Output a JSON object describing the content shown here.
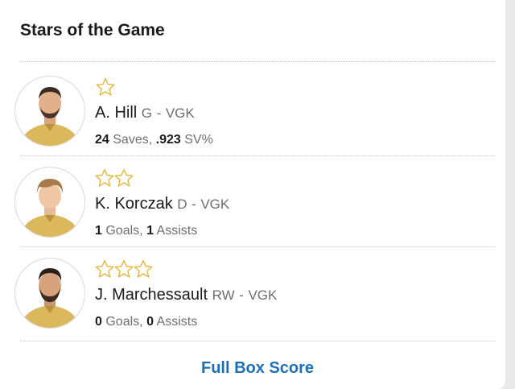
{
  "section": {
    "title": "Stars of the Game"
  },
  "colors": {
    "star_outline": "#e6b73a",
    "jersey_gold": "#dcb85c",
    "link_blue": "#1d6fb8"
  },
  "stars": [
    {
      "rank": 1,
      "star_count": 1,
      "name": "A. Hill",
      "position": "G",
      "team": "VGK",
      "stats": [
        {
          "value": "24",
          "label": "Saves,"
        },
        {
          "value": ".923",
          "label": "SV%"
        }
      ]
    },
    {
      "rank": 2,
      "star_count": 2,
      "name": "K. Korczak",
      "position": "D",
      "team": "VGK",
      "stats": [
        {
          "value": "1",
          "label": "Goals,"
        },
        {
          "value": "1",
          "label": "Assists"
        }
      ]
    },
    {
      "rank": 3,
      "star_count": 3,
      "name": "J. Marchessault",
      "position": "RW",
      "team": "VGK",
      "stats": [
        {
          "value": "0",
          "label": "Goals,"
        },
        {
          "value": "0",
          "label": "Assists"
        }
      ]
    }
  ],
  "footer": {
    "link_label": "Full Box Score"
  }
}
